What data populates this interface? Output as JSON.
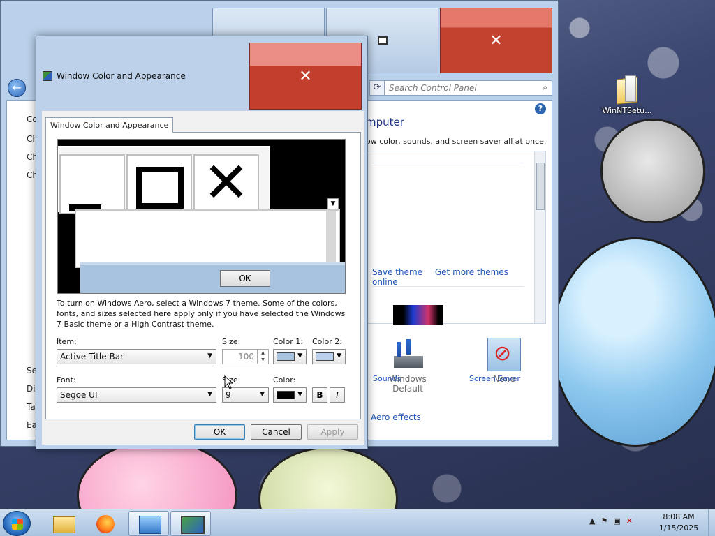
{
  "desktop": {
    "icons": [
      {
        "label": "WinNTSetu..."
      }
    ]
  },
  "control_panel": {
    "search_placeholder": "Search Control Panel",
    "heading": "mputer",
    "subheading": "ow color, sounds, and screen saver all at once.",
    "left_links": [
      "Co",
      "Ch",
      "Ch",
      "Ch"
    ],
    "left_bottom": [
      "Se",
      "Dis",
      "Ta",
      "Ea"
    ],
    "theme_links": {
      "save": "Save theme",
      "more": "Get more themes online"
    },
    "items": [
      {
        "label": "Sounds",
        "value": "Windows Default",
        "icon": "sounds-icon"
      },
      {
        "label": "Screen Saver",
        "value": "None",
        "icon": "screen-saver-icon"
      }
    ],
    "aero_link": "Aero effects",
    "help": "?"
  },
  "dialog": {
    "title": "Window Color and Appearance",
    "close_glyph": "✕",
    "tab": "Window Color and Appearance",
    "preview": {
      "ok_label": "OK"
    },
    "description": "To turn on Windows Aero, select a Windows 7 theme.  Some of the colors, fonts, and sizes selected here apply only if you have selected the Windows 7 Basic theme or a High Contrast theme.",
    "item": {
      "label": "Item:",
      "value": "Active Title Bar",
      "size_label": "Size:",
      "size_value": "100",
      "color1_label": "Color 1:",
      "color2_label": "Color 2:",
      "color1": "#a8c3e0",
      "color2": "#b9d1ee"
    },
    "font": {
      "label": "Font:",
      "value": "Segoe UI",
      "size_label": "Size:",
      "size_value": "9",
      "color_label": "Color:",
      "color": "#000000",
      "bold": "B",
      "italic": "I"
    },
    "buttons": {
      "ok": "OK",
      "cancel": "Cancel",
      "apply": "Apply"
    }
  },
  "taskbar": {
    "time": "8:08 AM",
    "date": "1/15/2025",
    "tray_arrow": "▲"
  }
}
